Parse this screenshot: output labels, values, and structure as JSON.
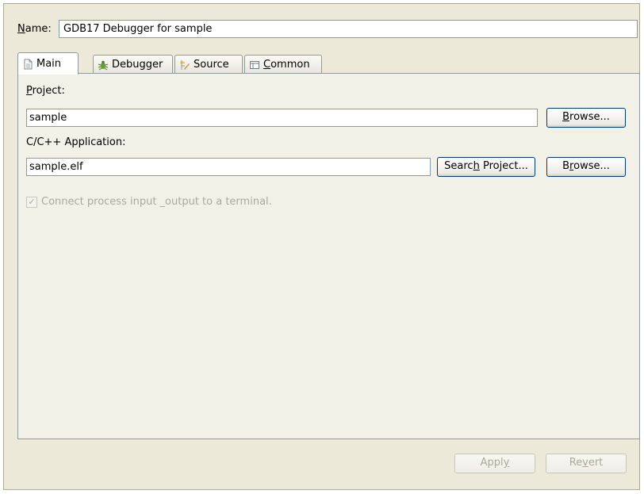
{
  "name": {
    "label": "Name:",
    "mnemonic": "N",
    "label_rest": "ame:",
    "value": "GDB17 Debugger for sample"
  },
  "tabs": [
    {
      "label": "Main",
      "mnemonic": "",
      "icon": "main-icon",
      "active": true
    },
    {
      "label": "Debugger",
      "mnemonic": "",
      "icon": "debugger-icon",
      "active": false
    },
    {
      "label": "Source",
      "mnemonic": "",
      "icon": "source-icon",
      "active": false
    },
    {
      "label": "Common",
      "mnemonic": "C",
      "label_rest": "ommon",
      "icon": "common-icon",
      "active": false
    }
  ],
  "main": {
    "project_label": "Project:",
    "project_label_mn": "P",
    "project_label_rest": "roject:",
    "project_value": "sample",
    "browse1": {
      "mn": "B",
      "rest": "rowse..."
    },
    "app_label": "C/C++ Application:",
    "app_value": "sample.elf",
    "search_project": {
      "pre": "Searc",
      "mn": "h",
      "rest": " Project..."
    },
    "browse2": {
      "pre": "B",
      "mn": "r",
      "rest": "owse..."
    },
    "terminal_checkbox": {
      "label": "Connect process input _output to a terminal.",
      "checked": true,
      "enabled": false
    }
  },
  "footer": {
    "apply": {
      "pre": "Appl",
      "mn": "y",
      "rest": ""
    },
    "revert": {
      "pre": "Re",
      "mn": "v",
      "rest": "ert"
    }
  },
  "colors": {
    "dialog_bg": "#ece9d8",
    "panel_bg": "#f2f1e8",
    "field_border": "#7f9db9",
    "button_border": "#003c74",
    "disabled_text": "#aca899"
  }
}
